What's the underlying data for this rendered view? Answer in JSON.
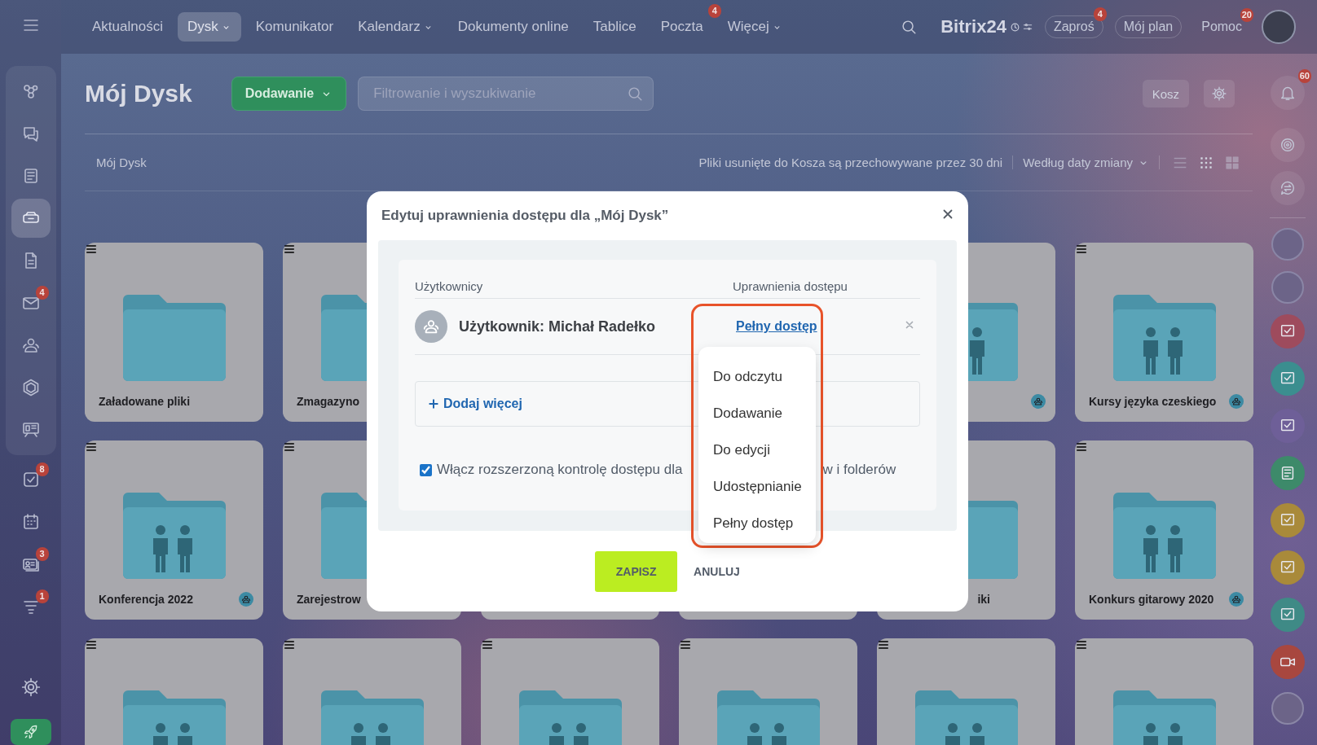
{
  "top_nav": {
    "items": [
      {
        "label": "Aktualności",
        "selected": false,
        "dropdown": false
      },
      {
        "label": "Dysk",
        "selected": true,
        "dropdown": true
      },
      {
        "label": "Komunikator",
        "selected": false,
        "dropdown": false
      },
      {
        "label": "Kalendarz",
        "selected": false,
        "dropdown": true
      },
      {
        "label": "Dokumenty online",
        "selected": false,
        "dropdown": false
      },
      {
        "label": "Tablice",
        "selected": false,
        "dropdown": false
      },
      {
        "label": "Poczta",
        "selected": false,
        "dropdown": false,
        "badge": "4"
      },
      {
        "label": "Więcej",
        "selected": false,
        "dropdown": true
      }
    ],
    "logo": "Bitrix24",
    "actions": [
      {
        "label": "Zaproś",
        "kind": "pill",
        "badge": "4"
      },
      {
        "label": "Mój plan",
        "kind": "pill"
      },
      {
        "label": "Pomoc",
        "kind": "plain",
        "badge": "20"
      }
    ]
  },
  "sidebar": {
    "pinned": [
      {
        "selected": false
      },
      {
        "selected": false
      },
      {
        "selected": false
      },
      {
        "selected": true
      },
      {
        "selected": false
      },
      {
        "selected": false,
        "badge": "4"
      },
      {
        "selected": false
      },
      {
        "selected": false
      },
      {
        "selected": false
      }
    ],
    "items": [
      {
        "selected": false,
        "badge": "8"
      },
      {
        "selected": false
      },
      {
        "selected": false,
        "badge": "3"
      },
      {
        "selected": false,
        "badge": "1"
      }
    ]
  },
  "header": {
    "title": "Mój Dysk",
    "add_button": "Dodawanie",
    "search_placeholder": "Filtrowanie i wyszukiwanie",
    "trash_button": "Kosz"
  },
  "toolbar": {
    "breadcrumb": "Mój Dysk",
    "notice": "Pliki usunięte do Kosza są przechowywane przez 30 dni",
    "sort": "Według daty zmiany",
    "views": [
      {
        "selected": false
      },
      {
        "selected": true
      },
      {
        "selected": false
      }
    ]
  },
  "card_rows": [
    {
      "left": [
        {
          "kind": "folder",
          "label": "Załadowane pliki",
          "shared": false
        },
        {
          "kind": "folder",
          "label": "Zmagazyno",
          "shared": false
        }
      ],
      "right": [
        {
          "kind": "shared_folder",
          "shared": true
        },
        {
          "kind": "shared_folder",
          "label": "Kursy języka czeskiego",
          "shared": true
        }
      ]
    },
    {
      "left": [
        {
          "kind": "shared_folder",
          "label": "Konferencja 2022",
          "shared": true
        },
        {
          "kind": "folder",
          "label": "Zarejestrow",
          "shared": false
        }
      ],
      "right": [
        {
          "kind": "folder",
          "label": "iki",
          "clipped": true,
          "shared": false
        },
        {
          "kind": "shared_folder",
          "label": "Konkurs gitarowy 2020",
          "shared": true
        }
      ]
    },
    {
      "left": [
        {
          "kind": "shared_folder"
        },
        {
          "kind": "shared_folder"
        },
        {
          "kind": "shared_folder"
        },
        {
          "kind": "shared_folder"
        },
        {
          "kind": "shared_folder"
        },
        {
          "kind": "shared_folder"
        }
      ]
    }
  ],
  "right_rail": {
    "notifications_badge": "60",
    "contacts": [
      {
        "kind": "avatar"
      },
      {
        "kind": "avatar"
      },
      {
        "kind": "chat",
        "color": "#9e4b5d"
      },
      {
        "kind": "chat",
        "color": "#3b8e8f"
      },
      {
        "kind": "chat",
        "color": "#6e5f98"
      },
      {
        "kind": "news",
        "color": "#3d8a6a"
      },
      {
        "kind": "chat",
        "color": "#a98a3a"
      },
      {
        "kind": "chat",
        "color": "#a98a3a"
      },
      {
        "kind": "chat",
        "color": "#3f8a86"
      },
      {
        "kind": "call",
        "color": "#a8473f"
      },
      {
        "kind": "avatar"
      }
    ]
  },
  "dialog": {
    "title": "Edytuj uprawnienia dostępu dla „Mój Dysk”",
    "columns": [
      "Użytkownicy",
      "Uprawnienia dostępu"
    ],
    "entries": [
      {
        "name": "Użytkownik: Michał Radełko",
        "access": "Pełny dostęp"
      }
    ],
    "add_more": "Dodaj więcej",
    "extended_control": {
      "checked": true,
      "text_before": "Włącz rozszerzoną kontrolę dostępu dla",
      "text_after": "w i folderów"
    },
    "access_menu": {
      "highlighted": true,
      "options": [
        "Do odczytu",
        "Dodawanie",
        "Do edycji",
        "Udostępnianie",
        "Pełny dostęp"
      ]
    },
    "save": "ZAPISZ",
    "cancel": "ANULUJ"
  }
}
